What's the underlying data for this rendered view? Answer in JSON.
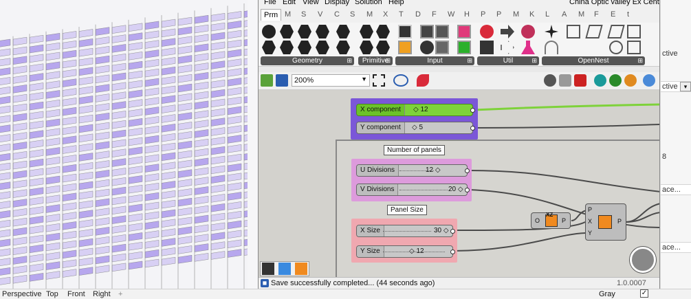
{
  "gh_menu": [
    "File",
    "Edit",
    "View",
    "Display",
    "Solution",
    "Help"
  ],
  "gh_title": "China Optic valley Ex Center",
  "tabs": [
    "Prm",
    "M",
    "S",
    "V",
    "C",
    "S",
    "M",
    "X",
    "T",
    "D",
    "F",
    "W",
    "H",
    "P",
    "P",
    "M",
    "K",
    "L",
    "A",
    "M",
    "F",
    "E",
    "t"
  ],
  "ribbon_groups": {
    "geometry": "Geometry",
    "primitive": "Primitive",
    "input": "Input",
    "util": "Util",
    "opennest": "OpenNest"
  },
  "zoom": "200%",
  "canvas": {
    "x_component": {
      "label": "X component",
      "value": "12"
    },
    "y_component": {
      "label": "Y component",
      "value": "5"
    },
    "number_of_panels": "Number of panels",
    "u_divisions": {
      "label": "U Divisions",
      "value": "12"
    },
    "v_divisions": {
      "label": "V Divisions",
      "value": "20"
    },
    "panel_size": "Panel Size",
    "x_size": {
      "label": "X Size",
      "value": "30"
    },
    "y_size": {
      "label": "Y Size",
      "value": "12"
    },
    "xz_plane": {
      "in": "O",
      "name": "XZ",
      "out": "P"
    },
    "rect": {
      "in_p": "P",
      "in_x": "X",
      "in_y": "Y",
      "out": "P"
    }
  },
  "status": "Save successfully completed... (44 seconds ago)",
  "version": "1.0.0007",
  "viewport_tabs": [
    "Perspective",
    "Top",
    "Front",
    "Right"
  ],
  "add_tab": "+",
  "gray_label": "Gray",
  "gray_checked": "✓",
  "right_panel": {
    "t1": "ctive",
    "t2": "ctive",
    "t3": "8",
    "t4": "ace...",
    "t5": "ace..."
  },
  "colors": {
    "group_blue": "#7b57d8",
    "group_pink": "#dd9bdc",
    "group_red": "#f0a8b0",
    "slider_green": "#7ed23a",
    "wire": "#4a4a4a",
    "wire_green": "#7ed23a"
  }
}
